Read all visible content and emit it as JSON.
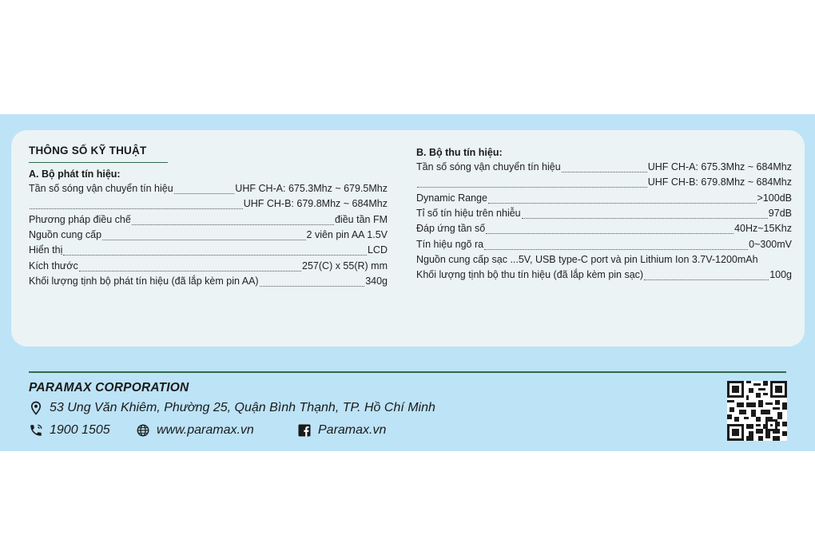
{
  "spec": {
    "title": "THÔNG SỐ KỸ THUẬT",
    "transmitter": {
      "heading": "A. Bộ phát tín hiệu:",
      "rows": [
        {
          "k": "Tần số sóng vận chuyển tín hiệu",
          "v": "UHF CH-A: 675.3Mhz ~ 679.5Mhz"
        },
        {
          "k": "",
          "v": "UHF CH-B: 679.8Mhz ~ 684Mhz"
        },
        {
          "k": "Phương pháp điều chế",
          "v": "điều tần FM"
        },
        {
          "k": "Nguồn cung cấp",
          "v": "2 viên pin AA 1.5V"
        },
        {
          "k": "Hiển thị",
          "v": "LCD"
        },
        {
          "k": "Kích thước",
          "v": "257(C) x 55(R) mm"
        },
        {
          "k": "Khối lượng tịnh bộ phát tín hiệu (đã lắp kèm pin AA)",
          "v": "340g"
        }
      ]
    },
    "receiver": {
      "heading": "B. Bộ thu tín hiệu:",
      "rows": [
        {
          "k": "Tần số sóng vận chuyển tín hiệu",
          "v": "UHF CH-A: 675.3Mhz ~ 684Mhz"
        },
        {
          "k": "",
          "v": "UHF CH-B: 679.8Mhz ~ 684Mhz"
        },
        {
          "k": "Dynamic Range",
          "v": ">100dB"
        },
        {
          "k": "Tỉ số tín hiệu trên nhiễu",
          "v": "97dB"
        },
        {
          "k": "Đáp ứng tần số",
          "v": "40Hz~15Khz"
        },
        {
          "k": "Tín hiệu ngõ ra",
          "v": "0~300mV"
        },
        {
          "k": "Nguồn cung cấp sạc ...5V, USB type-C port và pin Lithium Ion 3.7V-1200mAh",
          "v": ""
        },
        {
          "k": "Khối lượng tịnh bộ thu tín hiệu (đã lắp kèm pin sạc)",
          "v": "100g"
        }
      ]
    }
  },
  "footer": {
    "company": "PARAMAX CORPORATION",
    "address": "53 Ung Văn Khiêm, Phường 25, Quận Bình Thạnh, TP. Hồ Chí Minh",
    "phone": "1900 1505",
    "website": "www.paramax.vn",
    "facebook": "Paramax.vn",
    "icons": [
      "location-pin-icon",
      "phone-icon",
      "globe-icon",
      "facebook-icon",
      "qr-code"
    ]
  },
  "colors": {
    "band": "#bde3f7",
    "card": "#ebf3f5",
    "rule": "#2f6b4e"
  }
}
